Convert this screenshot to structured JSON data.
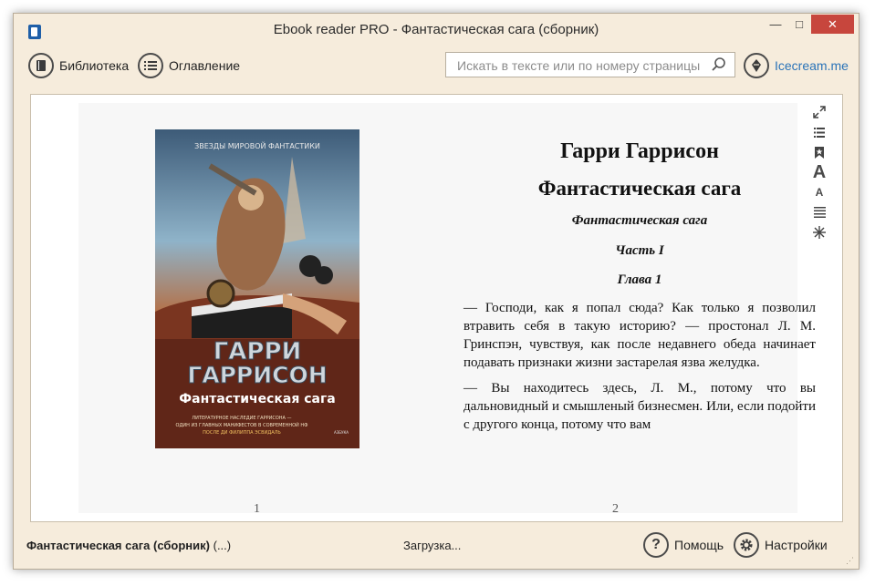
{
  "window": {
    "title": "Ebook reader PRO - Фантастическая сага (сборник)",
    "controls": {
      "minimize": "—",
      "maximize": "□",
      "close": "✕"
    }
  },
  "toolbar": {
    "library_label": "Библиотека",
    "contents_label": "Оглавление",
    "search_placeholder": "Искать в тексте или по номеру страницы",
    "brand_label": "Icecream.me"
  },
  "cover": {
    "series": "ЗВЕЗДЫ МИРОВОЙ ФАНТАСТИКИ",
    "author_line1": "ГАРРИ",
    "author_line2": "ГАРРИСОН",
    "title": "Фантастическая сага",
    "blurb1": "ЛИТЕРАТУРНОЕ НАСЛЕДИЕ ГАРРИСОНА —",
    "blurb2": "ОДИН ИЗ ГЛАВНЫХ МАНИФЕСТОВ В СОВРЕМЕННОЙ НФ",
    "blurb3": "ПОСЛЕ ДИ ФИЛИППА ЭСВИДАЛЬ",
    "publisher": "АЗБУКА"
  },
  "book_text": {
    "author": "Гарри Гаррисон",
    "title": "Фантастическая сага",
    "subtitle": "Фантастическая сага",
    "part": "Часть I",
    "chapter": "Глава 1",
    "paragraph1": "— Господи, как я попал сюда? Как только я позволил втравить себя в такую историю? — простонал Л. М. Гринспэн, чувствуя, как после недавнего обеда начинает подавать признаки жизни застарелая язва желудка.",
    "paragraph2": "— Вы находитесь здесь, Л. М., потому что вы дальновидный и смышленый бизнесмен. Или, если подойти с другого конца, потому что вам"
  },
  "pages": {
    "left": "1",
    "right": "2"
  },
  "status": {
    "book_title": "Фантастическая сага (сборник)",
    "book_suffix": " (...)",
    "loading": "Загрузка...",
    "help_label": "Помощь",
    "settings_label": "Настройки"
  },
  "colors": {
    "window_bg": "#f6ecdc",
    "link": "#2a73b8",
    "close_button": "#c7463d"
  }
}
